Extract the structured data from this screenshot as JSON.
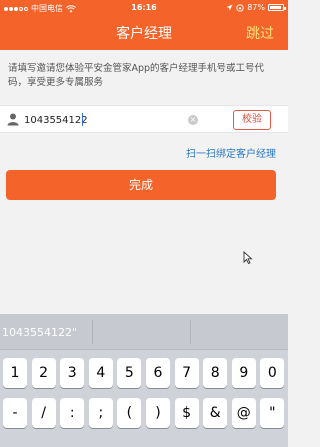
{
  "status_bar": {
    "carrier": "中国电信",
    "time": "16:16",
    "battery_text": "87%",
    "battery_level": 0.87
  },
  "nav": {
    "title": "客户经理",
    "skip_label": "跳过"
  },
  "instruction": "请填写邀请您体验平安金管家App的客户经理手机号或工号代码，享受更多专属服务",
  "phone_field": {
    "value": "1043554122",
    "verify_label": "校验"
  },
  "scan_link": "扫一扫绑定客户经理",
  "done_label": "完成",
  "keyboard": {
    "suggestion": "1043554122\"",
    "rows": [
      [
        "1",
        "2",
        "3",
        "4",
        "5",
        "6",
        "7",
        "8",
        "9",
        "0"
      ],
      [
        "-",
        "/",
        ":",
        ";",
        "(",
        ")",
        "$",
        "&",
        "@",
        "\""
      ]
    ]
  },
  "colors": {
    "brand_orange": "#f4632a",
    "skip_yellow": "#ffe27a",
    "link_blue": "#2a78c8"
  }
}
